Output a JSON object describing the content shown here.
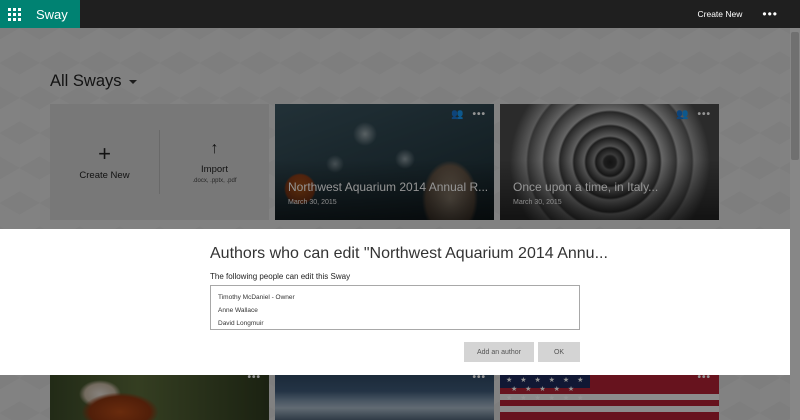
{
  "topbar": {
    "brand": "Sway",
    "create_new": "Create New",
    "more": "•••",
    "launcher_icon": "app-launcher-icon"
  },
  "section": {
    "title": "All Sways"
  },
  "actions": {
    "create_new": {
      "icon": "+",
      "label": "Create New"
    },
    "import": {
      "icon": "↑",
      "label": "Import",
      "sub": ".docx, .pptx, .pdf"
    }
  },
  "cards": [
    {
      "title": "Northwest Aquarium 2014 Annual R...",
      "date": "March 30, 2015",
      "shared": true
    },
    {
      "title": "Once upon a time, in Italy...",
      "date": "March 30, 2015",
      "shared": true
    }
  ],
  "bottom_cards": [
    {
      "more": "•••"
    },
    {
      "more": "•••"
    },
    {
      "more": "•••",
      "stars": "★ ★ ★ ★ ★ ★\n ★ ★ ★ ★ ★\n★ ★ ★ ★ ★ ★"
    }
  ],
  "dialog": {
    "title": "Authors who can edit \"Northwest Aquarium 2014 Annu...",
    "subtitle": "The following people can edit this Sway",
    "authors": [
      "Timothy McDaniel - Owner",
      "Anne Wallace",
      "David Longmuir"
    ],
    "add_author_label": "Add an author",
    "ok_label": "OK"
  },
  "icons": {
    "people": "👥",
    "more": "•••"
  },
  "colors": {
    "brand": "#008272",
    "topbar": "#1f1f1f"
  }
}
